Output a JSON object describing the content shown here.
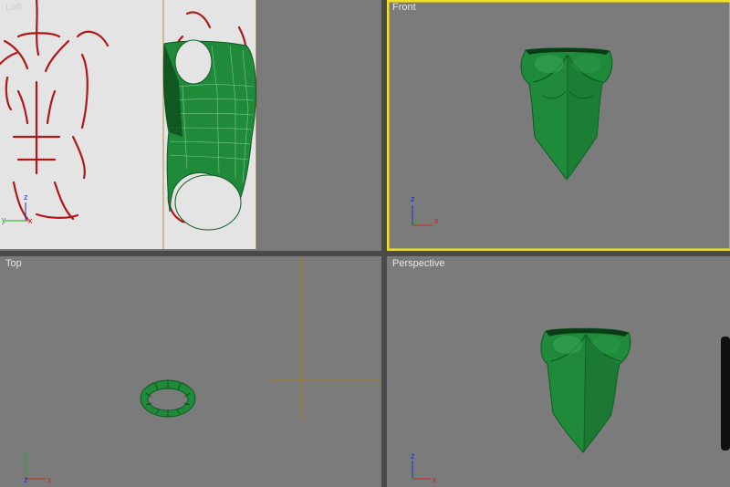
{
  "viewports": {
    "left": {
      "label": "Left"
    },
    "front": {
      "label": "Front"
    },
    "top": {
      "label": "Top"
    },
    "perspective": {
      "label": "Perspective"
    }
  },
  "axes": {
    "x": "x",
    "y": "y",
    "z": "z"
  },
  "colors": {
    "viewport_bg": "#7b7b7b",
    "active_border": "#f0e020",
    "mesh_green": "#1f8a3a",
    "mesh_dark": "#0e5a22",
    "sketch_red": "#b01818",
    "x_axis": "#cc2222",
    "y_axis": "#22aa22",
    "z_axis": "#2233cc",
    "crosshair": "#a07818"
  }
}
